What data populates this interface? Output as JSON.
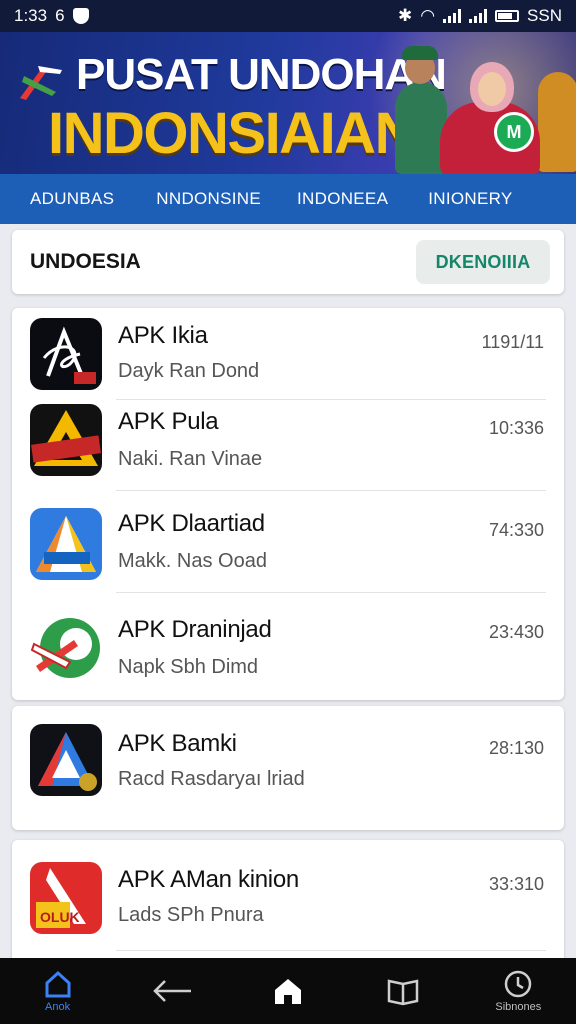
{
  "status_bar": {
    "time": "1:33",
    "indicator": "6",
    "right_text": "SSN"
  },
  "banner": {
    "title": "PUSAT UNDOHAN",
    "subtitle": "INDONSIAIAN",
    "badge": "M",
    "colors": {
      "title": "#ffffff",
      "subtitle": "#f5c21b"
    }
  },
  "tabs": [
    {
      "label": "ADUNBAS"
    },
    {
      "label": "NNDONSINE"
    },
    {
      "label": "INDONEEA"
    },
    {
      "label": "INIONERY"
    }
  ],
  "header": {
    "title": "UNDOESIA",
    "button_label": "DKENOIIIA"
  },
  "items": [
    {
      "name": "APK Ikia",
      "sub": "Dayk  Ran Dond",
      "time": "1191/11",
      "icon": "stylized-a-logo-icon",
      "icon_badge": "RIC"
    },
    {
      "name": "APK Pula",
      "sub": "Naki. Ran Vinae",
      "time": "10:336",
      "icon": "yellow-triangle-icon",
      "icon_badge": "BONUS"
    },
    {
      "name": "APK Dlaartiad",
      "sub": "Makk. Nas Ooad",
      "time": "74:330",
      "icon": "blue-triangle-icon",
      "icon_badge": ""
    },
    {
      "name": "APK Draninjad",
      "sub": "Napk  Sbh Dimd",
      "time": "23:430",
      "icon": "green-red-arrow-icon",
      "icon_badge": ""
    },
    {
      "name": "APK Bamki",
      "sub": "Racd  Rasdaryaı lriad",
      "time": "28:130",
      "icon": "tricolor-triangle-icon",
      "icon_badge": ""
    },
    {
      "name": "APK AMan kinion",
      "sub": "Lads  SPh Pnura",
      "time": "33:310",
      "icon": "red-yellow-a-icon",
      "icon_badge": "OLUK"
    }
  ],
  "bottom_nav": [
    {
      "label": "Anok",
      "icon": "home-outline-icon"
    },
    {
      "label": "",
      "icon": "back-arrow-icon"
    },
    {
      "label": "",
      "icon": "home-filled-icon"
    },
    {
      "label": "",
      "icon": "book-icon"
    },
    {
      "label": "Sibnones",
      "icon": "clock-icon"
    }
  ]
}
